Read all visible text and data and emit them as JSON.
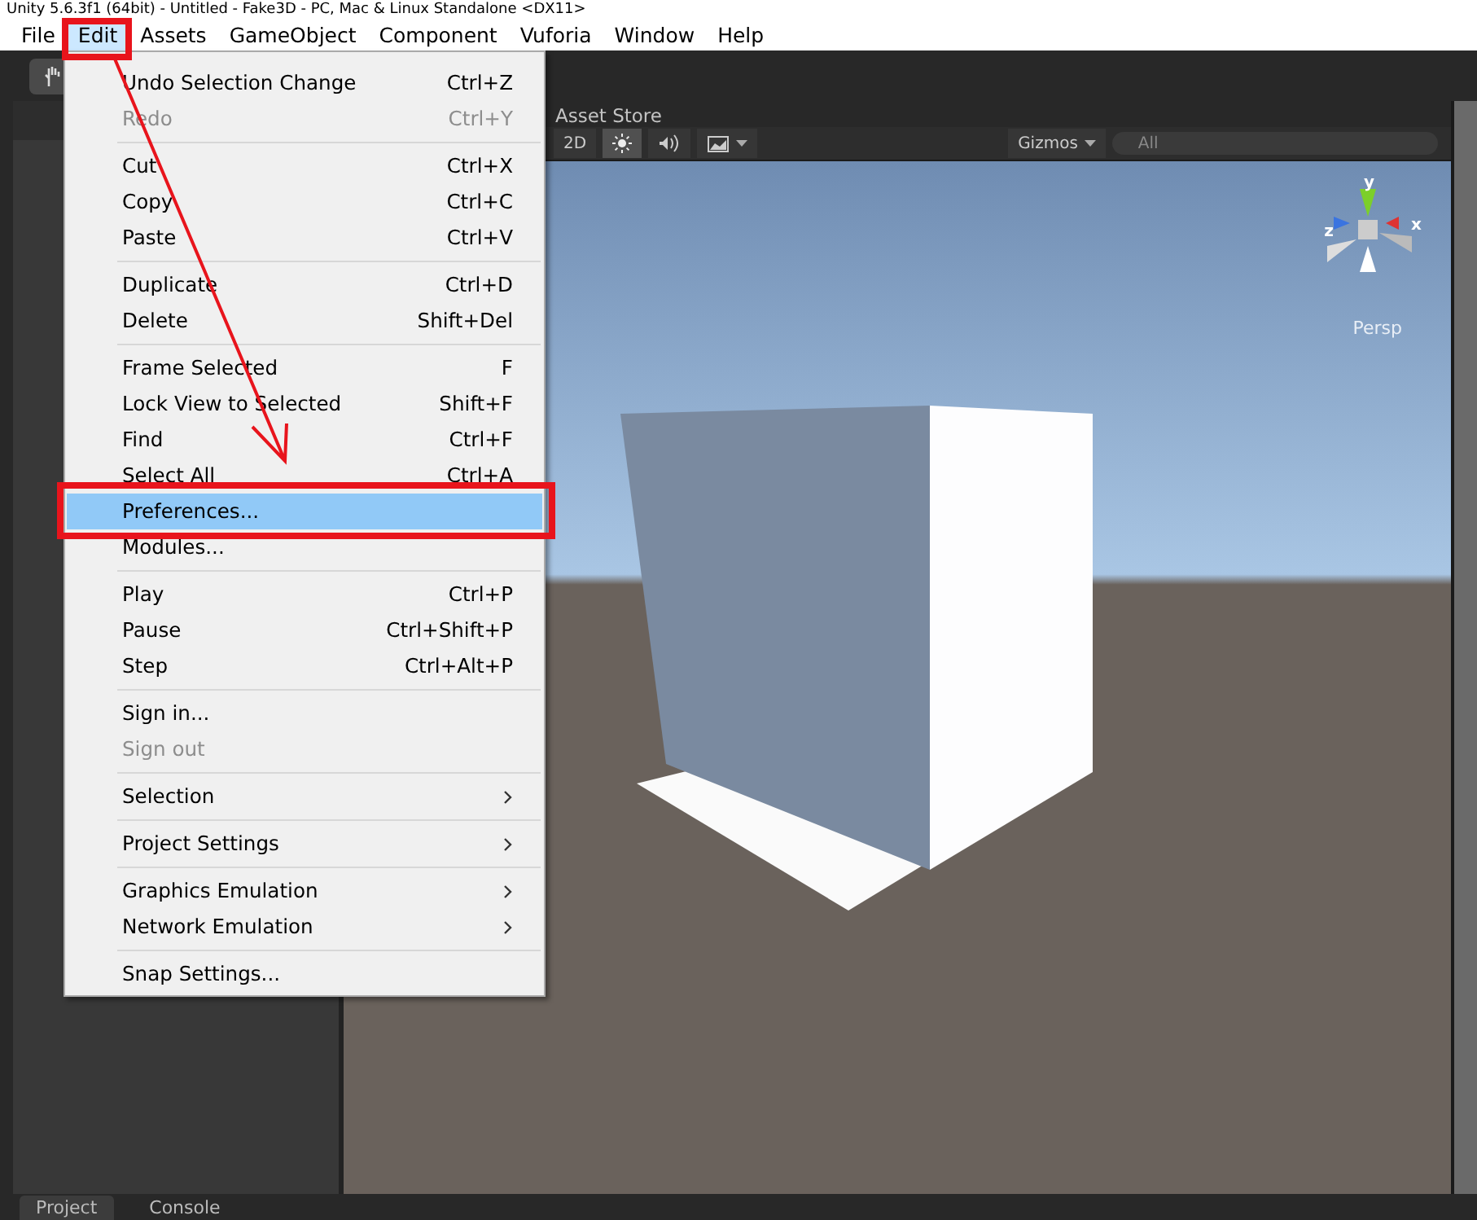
{
  "window": {
    "title": "Unity 5.6.3f1 (64bit) - Untitled - Fake3D - PC, Mac & Linux Standalone <DX11>"
  },
  "menubar": [
    {
      "label": "File",
      "selected": false
    },
    {
      "label": "Edit",
      "selected": true
    },
    {
      "label": "Assets",
      "selected": false
    },
    {
      "label": "GameObject",
      "selected": false
    },
    {
      "label": "Component",
      "selected": false
    },
    {
      "label": "Vuforia",
      "selected": false
    },
    {
      "label": "Window",
      "selected": false
    },
    {
      "label": "Help",
      "selected": false
    }
  ],
  "edit_menu": {
    "groups": [
      [
        {
          "label": "Undo Selection Change",
          "shortcut": "Ctrl+Z",
          "disabled": false,
          "selected": false,
          "submenu": false
        },
        {
          "label": "Redo",
          "shortcut": "Ctrl+Y",
          "disabled": true,
          "selected": false,
          "submenu": false
        }
      ],
      [
        {
          "label": "Cut",
          "shortcut": "Ctrl+X",
          "disabled": false,
          "selected": false,
          "submenu": false
        },
        {
          "label": "Copy",
          "shortcut": "Ctrl+C",
          "disabled": false,
          "selected": false,
          "submenu": false
        },
        {
          "label": "Paste",
          "shortcut": "Ctrl+V",
          "disabled": false,
          "selected": false,
          "submenu": false
        }
      ],
      [
        {
          "label": "Duplicate",
          "shortcut": "Ctrl+D",
          "disabled": false,
          "selected": false,
          "submenu": false
        },
        {
          "label": "Delete",
          "shortcut": "Shift+Del",
          "disabled": false,
          "selected": false,
          "submenu": false
        }
      ],
      [
        {
          "label": "Frame Selected",
          "shortcut": "F",
          "disabled": false,
          "selected": false,
          "submenu": false
        },
        {
          "label": "Lock View to Selected",
          "shortcut": "Shift+F",
          "disabled": false,
          "selected": false,
          "submenu": false
        },
        {
          "label": "Find",
          "shortcut": "Ctrl+F",
          "disabled": false,
          "selected": false,
          "submenu": false
        },
        {
          "label": "Select All",
          "shortcut": "Ctrl+A",
          "disabled": false,
          "selected": false,
          "submenu": false
        },
        {
          "label": "Preferences...",
          "disabled": false,
          "selected": true,
          "submenu": false
        },
        {
          "label": "Modules...",
          "disabled": false,
          "selected": false,
          "submenu": false
        }
      ],
      [
        {
          "label": "Play",
          "shortcut": "Ctrl+P",
          "disabled": false,
          "selected": false,
          "submenu": false
        },
        {
          "label": "Pause",
          "shortcut": "Ctrl+Shift+P",
          "disabled": false,
          "selected": false,
          "submenu": false
        },
        {
          "label": "Step",
          "shortcut": "Ctrl+Alt+P",
          "disabled": false,
          "selected": false,
          "submenu": false
        }
      ],
      [
        {
          "label": "Sign in...",
          "disabled": false,
          "selected": false,
          "submenu": false
        },
        {
          "label": "Sign out",
          "disabled": true,
          "selected": false,
          "submenu": false
        }
      ],
      [
        {
          "label": "Selection",
          "disabled": false,
          "selected": false,
          "submenu": true
        }
      ],
      [
        {
          "label": "Project Settings",
          "disabled": false,
          "selected": false,
          "submenu": true
        }
      ],
      [
        {
          "label": "Graphics Emulation",
          "disabled": false,
          "selected": false,
          "submenu": true
        },
        {
          "label": "Network Emulation",
          "disabled": false,
          "selected": false,
          "submenu": true
        }
      ],
      [
        {
          "label": "Snap Settings...",
          "disabled": false,
          "selected": false,
          "submenu": false
        }
      ]
    ]
  },
  "scene": {
    "tab": "Asset Store",
    "toolbar": {
      "mode": "2D",
      "lighting_on": true,
      "audio_on": false,
      "effects_on": false,
      "gizmos": "Gizmos",
      "search": {
        "placeholder": "All"
      }
    },
    "gizmo_axes": {
      "y": "y",
      "x": "x",
      "z": "z"
    },
    "projection": "Persp"
  },
  "bottom_tabs": [
    {
      "label": "Project",
      "selected": true
    },
    {
      "label": "Console",
      "selected": false
    }
  ]
}
